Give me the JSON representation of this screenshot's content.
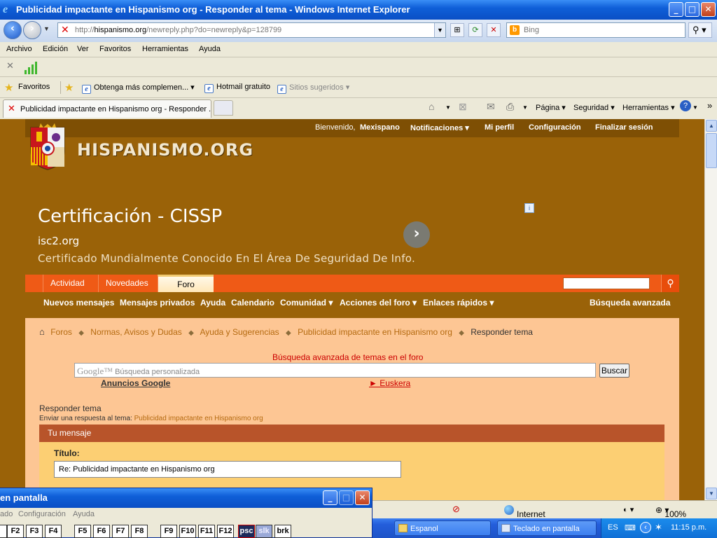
{
  "window": {
    "title": "Publicidad impactante en Hispanismo org - Responder al tema - Windows Internet Explorer",
    "min": "_",
    "max": "□",
    "close": "✕"
  },
  "address": {
    "url_prefix": "http://",
    "url_domain": "hispanismo.org",
    "url_path": "/newreply.php?do=newreply&p=128799",
    "search_placeholder": "Bing"
  },
  "menu": [
    "Archivo",
    "Edición",
    "Ver",
    "Favoritos",
    "Herramientas",
    "Ayuda"
  ],
  "favorites": {
    "label": "Favoritos",
    "items": [
      {
        "label": "Obtenga más complemen... ▾"
      },
      {
        "label": "Hotmail gratuito"
      },
      {
        "label": "Sitios sugeridos ▾"
      }
    ]
  },
  "tab": {
    "label": "Publicidad impactante en Hispanismo org - Responder ..."
  },
  "commandbar": {
    "pagina": "Página ▾",
    "seguridad": "Seguridad ▾",
    "herramientas": "Herramientas ▾",
    "more": "»"
  },
  "site": {
    "welcome": "Bienvenido,",
    "username": "Mexispano",
    "links": [
      "Notificaciones ▾",
      "Mi perfil",
      "Configuración",
      "Finalizar sesión"
    ],
    "logo_text": "HISPANISMO.ORG"
  },
  "ad": {
    "headline": "Certificación - CISSP",
    "source": "isc2.org",
    "description": "Certificado Mundialmente Conocido En El Área De Seguridad De Info."
  },
  "navbar": {
    "tabs": [
      {
        "label": "Actividad"
      },
      {
        "label": "Novedades"
      },
      {
        "label": "Foro"
      }
    ],
    "subnav": [
      "Nuevos mensajes",
      "Mensajes privados",
      "Ayuda",
      "Calendario",
      "Comunidad ▾",
      "Acciones del foro ▾",
      "Enlaces rápidos ▾"
    ],
    "advanced_search": "Búsqueda avanzada"
  },
  "breadcrumb": [
    "Foros",
    "Normas, Avisos y Dudas",
    "Ayuda y Sugerencias",
    "Publicidad impactante en Hispanismo org",
    "Responder tema"
  ],
  "search_section": {
    "title": "Búsqueda avanzada de temas en el foro",
    "google_label": "Google™",
    "placeholder": "Búsqueda personalizada",
    "button": "Buscar",
    "ads_link": "Anuncios Google",
    "euskera_link": "► Euskera"
  },
  "reply": {
    "heading": "Responder tema",
    "subtitle_prefix": "Enviar una respuesta al tema:",
    "subtitle_topic": "Publicidad impactante en Hispanismo org",
    "message_bar": "Tu mensaje",
    "title_label": "Título:",
    "title_value": "Re: Publicidad impactante en Hispanismo org"
  },
  "statusbar": {
    "zone": "Internet",
    "zoom": "100%"
  },
  "osk": {
    "title": "en pantalla",
    "menu": [
      "ado",
      "Configuración",
      "Ayuda"
    ],
    "keys": [
      "F2",
      "F3",
      "F4",
      "F5",
      "F6",
      "F7",
      "F8",
      "F9",
      "F10",
      "F11",
      "F12",
      "psc",
      "slk",
      "brk"
    ]
  },
  "taskbar": {
    "buttons": [
      {
        "label": "Espanol"
      },
      {
        "label": "Teclado en pantalla"
      }
    ],
    "lang": "ES",
    "time": "11:15 p.m."
  }
}
